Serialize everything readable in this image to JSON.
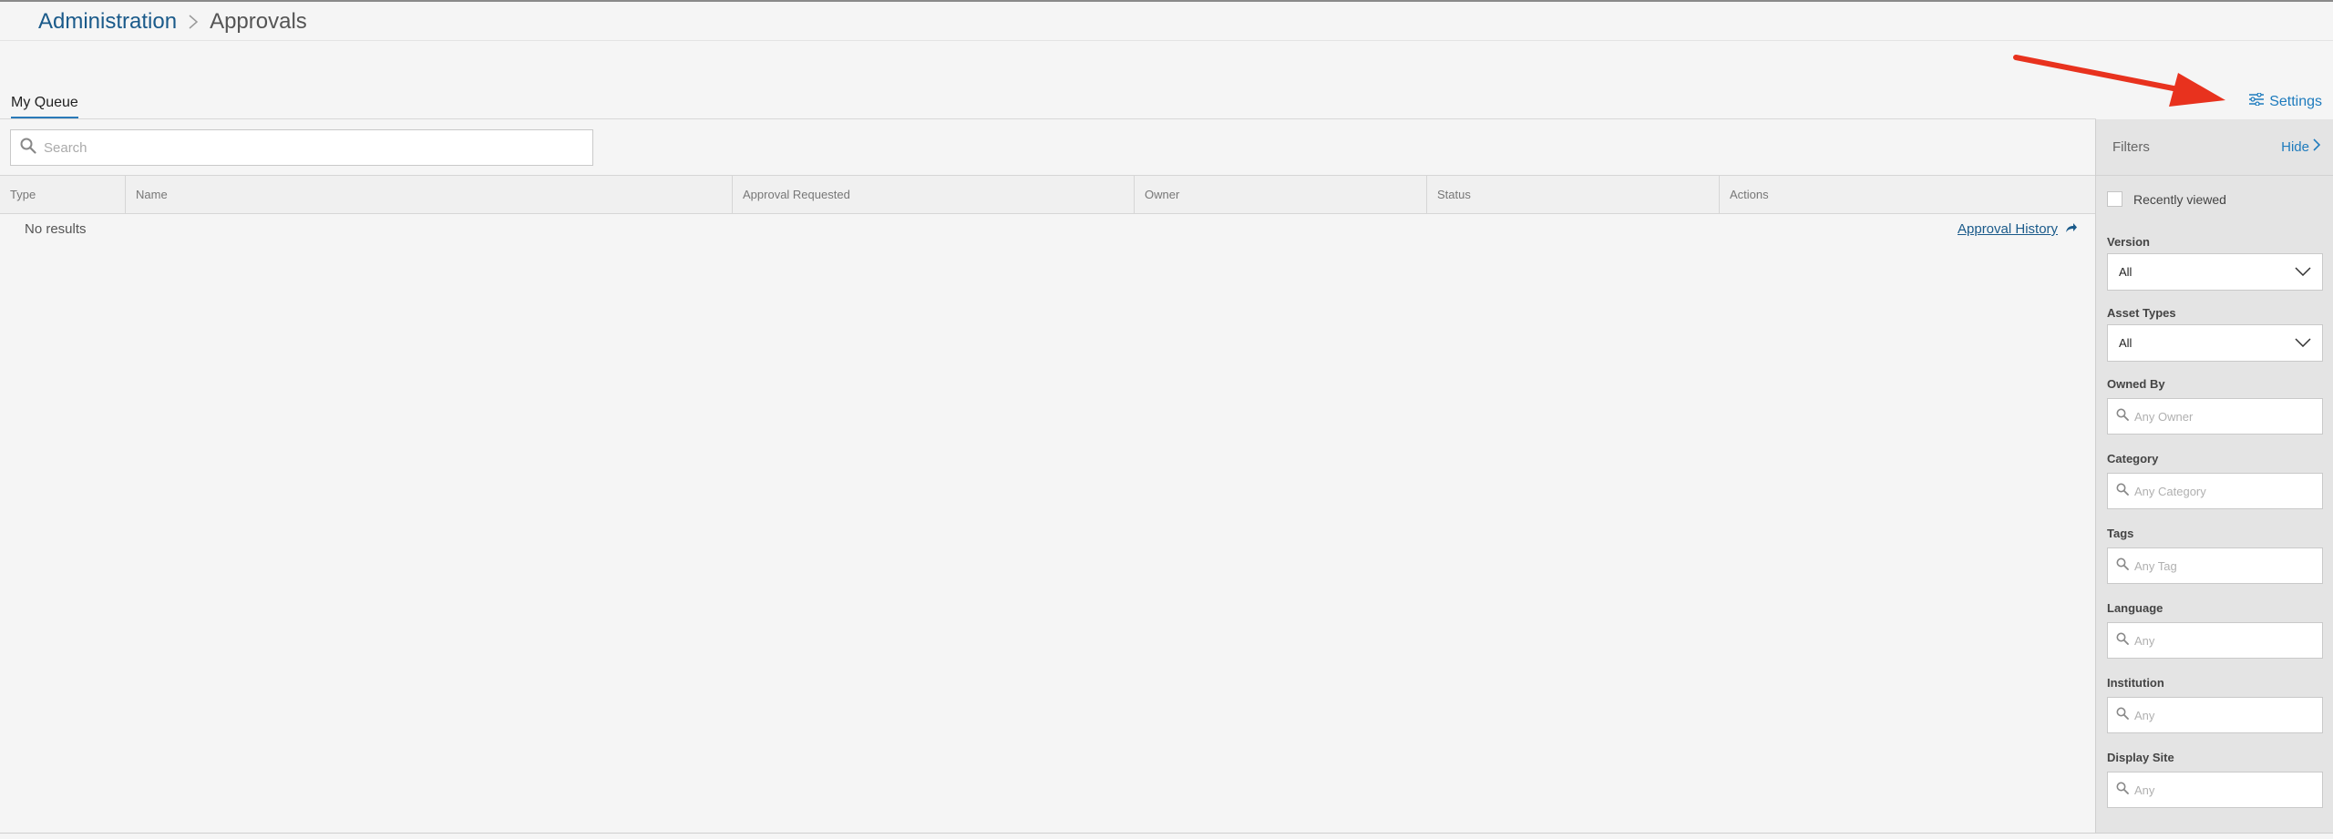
{
  "breadcrumb": {
    "root": "Administration",
    "current": "Approvals"
  },
  "tabs": [
    {
      "label": "My Queue",
      "active": true
    }
  ],
  "settings": {
    "label": "Settings",
    "icon": "sliders-icon"
  },
  "search": {
    "placeholder": "Search",
    "value": ""
  },
  "table": {
    "columns": [
      "Type",
      "Name",
      "Approval Requested",
      "Owner",
      "Status",
      "Actions"
    ],
    "empty_text": "No results"
  },
  "approval_history": {
    "label": "Approval History",
    "icon": "share-arrow-icon"
  },
  "filters": {
    "title": "Filters",
    "hide_label": "Hide",
    "recently_viewed_label": "Recently viewed",
    "recently_viewed_checked": false,
    "version": {
      "label": "Version",
      "value": "All"
    },
    "asset_types": {
      "label": "Asset Types",
      "value": "All"
    },
    "owned_by": {
      "label": "Owned By",
      "placeholder": "Any Owner"
    },
    "category": {
      "label": "Category",
      "placeholder": "Any Category"
    },
    "tags": {
      "label": "Tags",
      "placeholder": "Any Tag"
    },
    "language": {
      "label": "Language",
      "placeholder": "Any"
    },
    "institution": {
      "label": "Institution",
      "placeholder": "Any"
    },
    "display_site": {
      "label": "Display Site",
      "placeholder": "Any"
    }
  },
  "colors": {
    "accent": "#1e7bbd",
    "link": "#1a5a8a",
    "annotation": "#e8321e"
  }
}
